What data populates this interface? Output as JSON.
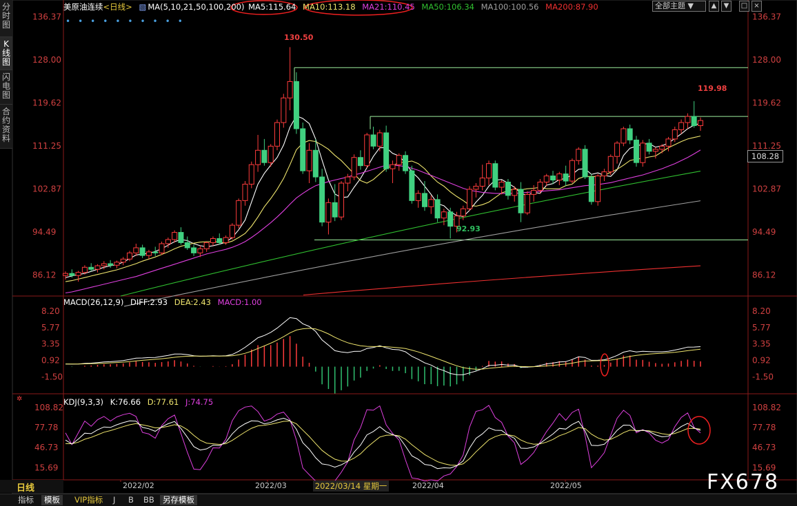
{
  "sidebar": {
    "tabs": [
      {
        "label": "分时图",
        "active": false
      },
      {
        "label": "K线图",
        "active": true
      },
      {
        "label": "闪电图",
        "active": false
      },
      {
        "label": "合约资料",
        "active": false
      }
    ]
  },
  "header": {
    "symbol": "美原油连续",
    "period": "<日线>",
    "ma_params": "MA(5,10,21,50,100,200)",
    "ma": [
      {
        "label": "MA5:115.64",
        "color": "#ffffff"
      },
      {
        "label": "MA10:113.18",
        "color": "#f0e66e"
      },
      {
        "label": "MA21:110.45",
        "color": "#e040e0"
      },
      {
        "label": "MA50:106.34",
        "color": "#30c030"
      },
      {
        "label": "MA100:100.56",
        "color": "#a0a0a0"
      },
      {
        "label": "MA200:87.90",
        "color": "#f03030"
      }
    ],
    "theme_select": "全部主题",
    "theme_arrow": "▼",
    "controls": [
      "▲",
      "▼",
      "□",
      "×"
    ]
  },
  "price_axis": [
    "136.37",
    "128.00",
    "119.62",
    "111.25",
    "102.87",
    "94.49",
    "86.12"
  ],
  "current_price": "108.28",
  "annotations": {
    "high": "130.50",
    "recent_high": "119.98",
    "low": "92.93"
  },
  "macd": {
    "label": "MACD(26,12,9)",
    "diff": "DIFF:2.93",
    "dea": "DEA:2.43",
    "macd": "MACD:1.00",
    "axis": [
      "8.20",
      "5.77",
      "3.35",
      "0.92",
      "-1.50"
    ]
  },
  "kdj": {
    "label": "KDJ(9,3,3)",
    "k": "K:76.66",
    "d": "D:77.61",
    "j": "J:74.75",
    "axis": [
      "108.82",
      "77.78",
      "46.73",
      "15.69"
    ]
  },
  "x_axis": [
    "2022/02",
    "2022/03",
    "2022/04",
    "2022/05"
  ],
  "cursor_date": "2022/03/14 星期一",
  "mode": "日线",
  "bottom_tabs": [
    {
      "label": "指标",
      "active": false
    },
    {
      "label": "模板",
      "active": true
    },
    {
      "label": "VIP指标",
      "active": false
    },
    {
      "label": "J",
      "active": false
    },
    {
      "label": "B",
      "active": false
    },
    {
      "label": "BB",
      "active": false
    },
    {
      "label": "另存模板",
      "active": true
    }
  ],
  "watermark": "FX678",
  "chart_data": {
    "type": "candlestick",
    "y_range": [
      82,
      137
    ],
    "support_line": 92.93,
    "resistance_lines": [
      126.5,
      117.0
    ],
    "candles": [
      [
        86.0,
        86.8,
        85.2,
        86.4
      ],
      [
        86.4,
        87.2,
        85.6,
        86.0
      ],
      [
        86.0,
        86.9,
        84.8,
        86.6
      ],
      [
        86.6,
        88.0,
        86.2,
        87.6
      ],
      [
        87.6,
        88.4,
        86.8,
        87.2
      ],
      [
        87.2,
        88.2,
        86.6,
        87.9
      ],
      [
        87.9,
        88.8,
        87.2,
        88.3
      ],
      [
        88.3,
        89.0,
        87.5,
        88.0
      ],
      [
        88.0,
        88.9,
        87.4,
        88.6
      ],
      [
        88.6,
        89.6,
        88.0,
        89.2
      ],
      [
        89.2,
        90.8,
        88.8,
        90.4
      ],
      [
        90.4,
        92.2,
        89.8,
        91.4
      ],
      [
        91.4,
        92.0,
        89.4,
        89.9
      ],
      [
        89.9,
        91.0,
        89.2,
        90.6
      ],
      [
        90.6,
        91.6,
        89.8,
        90.4
      ],
      [
        90.4,
        92.6,
        90.0,
        92.2
      ],
      [
        92.2,
        93.4,
        91.4,
        93.0
      ],
      [
        93.0,
        94.8,
        92.4,
        94.4
      ],
      [
        94.4,
        95.4,
        92.0,
        92.4
      ],
      [
        92.4,
        93.6,
        91.0,
        91.4
      ],
      [
        91.4,
        92.0,
        89.8,
        90.4
      ],
      [
        90.4,
        91.8,
        89.6,
        91.2
      ],
      [
        91.2,
        92.6,
        90.6,
        92.4
      ],
      [
        92.4,
        93.6,
        91.8,
        93.2
      ],
      [
        93.2,
        94.2,
        92.0,
        92.4
      ],
      [
        92.4,
        93.8,
        92.0,
        93.4
      ],
      [
        93.4,
        96.2,
        93.0,
        95.8
      ],
      [
        95.8,
        101.0,
        95.2,
        100.6
      ],
      [
        100.6,
        104.4,
        99.6,
        103.8
      ],
      [
        103.8,
        108.2,
        103.0,
        107.6
      ],
      [
        107.6,
        113.4,
        106.2,
        110.4
      ],
      [
        110.4,
        112.6,
        107.4,
        108.0
      ],
      [
        108.0,
        111.6,
        107.2,
        111.2
      ],
      [
        111.2,
        116.4,
        110.4,
        115.8
      ],
      [
        115.8,
        121.4,
        114.8,
        120.6
      ],
      [
        120.6,
        130.5,
        118.2,
        123.8
      ],
      [
        123.8,
        125.6,
        113.6,
        114.6
      ],
      [
        114.6,
        115.8,
        105.8,
        106.4
      ],
      [
        106.4,
        111.8,
        104.0,
        110.4
      ],
      [
        110.4,
        112.6,
        104.2,
        105.2
      ],
      [
        105.2,
        106.8,
        95.6,
        96.4
      ],
      [
        96.4,
        101.0,
        94.0,
        100.2
      ],
      [
        100.2,
        103.8,
        96.6,
        97.4
      ],
      [
        97.4,
        104.4,
        96.8,
        104.0
      ],
      [
        104.0,
        105.8,
        102.4,
        105.2
      ],
      [
        105.2,
        109.6,
        104.6,
        109.0
      ],
      [
        109.0,
        110.4,
        106.6,
        107.4
      ],
      [
        107.4,
        113.8,
        107.0,
        113.4
      ],
      [
        113.4,
        115.0,
        110.6,
        111.2
      ],
      [
        111.2,
        114.4,
        110.2,
        113.8
      ],
      [
        113.8,
        115.2,
        106.2,
        106.8
      ],
      [
        106.8,
        108.4,
        104.0,
        107.6
      ],
      [
        107.6,
        109.8,
        106.4,
        109.4
      ],
      [
        109.4,
        110.2,
        105.8,
        106.4
      ],
      [
        106.4,
        107.4,
        100.0,
        100.6
      ],
      [
        100.6,
        102.6,
        99.2,
        102.0
      ],
      [
        102.0,
        104.4,
        98.6,
        99.4
      ],
      [
        99.4,
        101.6,
        98.0,
        100.8
      ],
      [
        100.8,
        101.8,
        96.4,
        97.2
      ],
      [
        97.2,
        99.0,
        95.8,
        98.4
      ],
      [
        98.4,
        99.2,
        93.2,
        95.6
      ],
      [
        95.6,
        98.4,
        94.4,
        97.6
      ],
      [
        97.6,
        99.6,
        96.8,
        99.0
      ],
      [
        99.0,
        103.4,
        98.6,
        102.8
      ],
      [
        102.8,
        104.0,
        101.2,
        103.4
      ],
      [
        103.4,
        107.6,
        102.6,
        105.0
      ],
      [
        105.0,
        108.4,
        103.6,
        107.8
      ],
      [
        107.8,
        108.4,
        102.6,
        103.2
      ],
      [
        103.2,
        104.6,
        101.8,
        104.2
      ],
      [
        104.2,
        104.8,
        100.8,
        101.6
      ],
      [
        101.6,
        103.4,
        100.4,
        102.8
      ],
      [
        102.8,
        104.2,
        96.4,
        98.2
      ],
      [
        98.2,
        102.4,
        97.8,
        101.8
      ],
      [
        101.8,
        103.6,
        100.4,
        102.6
      ],
      [
        102.6,
        104.8,
        102.0,
        104.2
      ],
      [
        104.2,
        105.8,
        103.4,
        105.4
      ],
      [
        105.4,
        106.4,
        103.8,
        104.6
      ],
      [
        104.6,
        106.2,
        103.6,
        105.8
      ],
      [
        105.8,
        107.4,
        103.4,
        104.4
      ],
      [
        104.4,
        108.8,
        104.0,
        108.4
      ],
      [
        108.4,
        111.0,
        107.6,
        110.6
      ],
      [
        110.6,
        111.4,
        104.8,
        105.2
      ],
      [
        105.2,
        105.8,
        99.8,
        100.4
      ],
      [
        100.4,
        105.8,
        99.6,
        105.4
      ],
      [
        105.4,
        106.8,
        104.4,
        106.2
      ],
      [
        106.2,
        109.6,
        105.6,
        109.2
      ],
      [
        109.2,
        112.2,
        107.8,
        111.8
      ],
      [
        111.8,
        115.0,
        111.2,
        114.6
      ],
      [
        114.6,
        115.4,
        111.6,
        112.4
      ],
      [
        112.4,
        113.2,
        107.2,
        108.0
      ],
      [
        108.0,
        112.4,
        107.2,
        111.8
      ],
      [
        111.8,
        112.6,
        109.6,
        110.2
      ],
      [
        110.2,
        111.0,
        108.8,
        110.6
      ],
      [
        110.6,
        111.6,
        109.8,
        111.2
      ],
      [
        111.2,
        113.0,
        110.2,
        112.6
      ],
      [
        112.6,
        115.0,
        112.0,
        114.4
      ],
      [
        114.4,
        116.4,
        113.6,
        115.8
      ],
      [
        115.8,
        117.6,
        114.6,
        117.0
      ],
      [
        117.0,
        119.98,
        114.8,
        115.2
      ],
      [
        115.2,
        116.8,
        114.2,
        116.2
      ]
    ],
    "ma_series": [
      {
        "name": "MA5",
        "color": "#ffffff",
        "values": [
          85.6,
          85.9,
          86.2,
          86.4,
          86.8,
          87.2,
          87.6,
          87.9,
          88.1,
          88.6,
          89.3,
          90.0,
          90.2,
          90.3,
          90.7,
          91.2,
          91.9,
          92.6,
          93.0,
          92.8,
          92.2,
          91.8,
          91.6,
          91.8,
          92.1,
          92.5,
          93.4,
          94.9,
          96.8,
          100.3,
          103.8,
          105.9,
          107.5,
          109.0,
          111.4,
          114.9,
          117.1,
          116.6,
          115.6,
          112.6,
          108.5,
          104.6,
          101.9,
          101.2,
          101.3,
          103.2,
          104.9,
          107.0,
          109.2,
          110.9,
          110.9,
          109.8,
          109.3,
          107.9,
          106.2,
          105.0,
          103.4,
          101.8,
          100.0,
          99.6,
          98.4,
          97.7,
          97.5,
          98.7,
          100.3,
          101.6,
          103.4,
          104.6,
          104.7,
          104.0,
          103.2,
          102.0,
          101.6,
          102.2,
          102.0,
          103.6,
          103.9,
          104.7,
          104.9,
          105.7,
          106.7,
          106.8,
          105.7,
          106.0,
          105.5,
          105.3,
          106.6,
          109.4,
          110.8,
          111.2,
          111.6,
          111.7,
          111.0,
          111.3,
          111.8,
          112.7,
          113.6,
          114.6,
          115.3,
          115.64
        ]
      },
      {
        "name": "MA10",
        "color": "#f0e66e",
        "values": [
          84.8,
          85.0,
          85.3,
          85.6,
          85.9,
          86.2,
          86.5,
          86.8,
          87.1,
          87.5,
          87.9,
          88.3,
          88.8,
          89.2,
          89.6,
          90.1,
          90.6,
          91.2,
          91.7,
          92.0,
          92.3,
          92.5,
          92.6,
          92.6,
          92.5,
          92.3,
          92.7,
          93.4,
          94.2,
          95.6,
          97.4,
          99.4,
          101.0,
          102.8,
          104.9,
          107.6,
          110.5,
          111.8,
          112.3,
          112.1,
          111.4,
          110.6,
          109.4,
          108.4,
          107.1,
          105.8,
          104.5,
          104.0,
          104.7,
          105.8,
          106.9,
          107.4,
          108.0,
          108.1,
          108.3,
          107.8,
          106.8,
          105.4,
          104.2,
          103.4,
          102.3,
          101.4,
          100.6,
          99.7,
          99.5,
          99.8,
          100.3,
          101.2,
          102.1,
          102.5,
          102.9,
          102.7,
          102.9,
          103.0,
          103.2,
          102.9,
          102.9,
          102.9,
          103.5,
          103.8,
          104.9,
          105.3,
          105.3,
          105.3,
          105.5,
          106.1,
          106.7,
          107.5,
          108.4,
          108.7,
          108.8,
          109.1,
          109.3,
          110.1,
          110.9,
          111.5,
          112.1,
          112.6,
          112.9,
          113.18
        ]
      },
      {
        "name": "MA21",
        "color": "#e040e0",
        "values": [
          82.6,
          82.8,
          83.1,
          83.4,
          83.7,
          84.0,
          84.3,
          84.6,
          84.9,
          85.2,
          85.5,
          85.8,
          86.2,
          86.6,
          87.0,
          87.4,
          87.8,
          88.2,
          88.6,
          89.0,
          89.4,
          89.8,
          90.2,
          90.5,
          90.8,
          91.1,
          91.5,
          92.0,
          92.6,
          93.4,
          94.3,
          95.3,
          96.3,
          97.4,
          98.6,
          99.9,
          101.1,
          102.0,
          102.8,
          103.5,
          103.9,
          104.3,
          104.6,
          104.9,
          105.2,
          105.6,
          105.9,
          106.3,
          106.7,
          107.1,
          107.5,
          107.5,
          107.4,
          107.2,
          106.9,
          106.5,
          106.0,
          105.5,
          105.0,
          104.5,
          104.0,
          103.5,
          103.0,
          102.6,
          102.4,
          102.2,
          102.1,
          102.0,
          102.0,
          102.0,
          102.0,
          102.1,
          102.2,
          102.3,
          102.4,
          102.5,
          102.6,
          102.7,
          102.9,
          103.1,
          103.3,
          103.5,
          103.6,
          103.7,
          103.9,
          104.1,
          104.4,
          104.7,
          105.0,
          105.3,
          105.6,
          106.0,
          106.4,
          106.8,
          107.3,
          107.8,
          108.4,
          109.0,
          109.7,
          110.45
        ]
      },
      {
        "name": "MA50",
        "color": "#30c030",
        "values": [
          null,
          null,
          null,
          null,
          null,
          null,
          null,
          null,
          null,
          null,
          null,
          null,
          null,
          null,
          null,
          null,
          null,
          null,
          null,
          null,
          null,
          null,
          null,
          null,
          null,
          null,
          null,
          null,
          null,
          null,
          null,
          null,
          null,
          null,
          null,
          null,
          null,
          null,
          null,
          null,
          null,
          null,
          null,
          null,
          null,
          null,
          null,
          null,
          null,
          null,
          null,
          null,
          null,
          null,
          null,
          null,
          null,
          null,
          null,
          null,
          null,
          null,
          null,
          null,
          null,
          null,
          null,
          null,
          null,
          null,
          null,
          null,
          null,
          null,
          null,
          null,
          null,
          null,
          null,
          null,
          null,
          null,
          null,
          null,
          null,
          null,
          null,
          null,
          null,
          null,
          null,
          null,
          null,
          null,
          null,
          null,
          null,
          null,
          null,
          106.34
        ]
      },
      {
        "name": "MA100",
        "color": "#a0a0a0",
        "values": []
      },
      {
        "name": "MA200",
        "color": "#f03030",
        "values": []
      }
    ]
  }
}
